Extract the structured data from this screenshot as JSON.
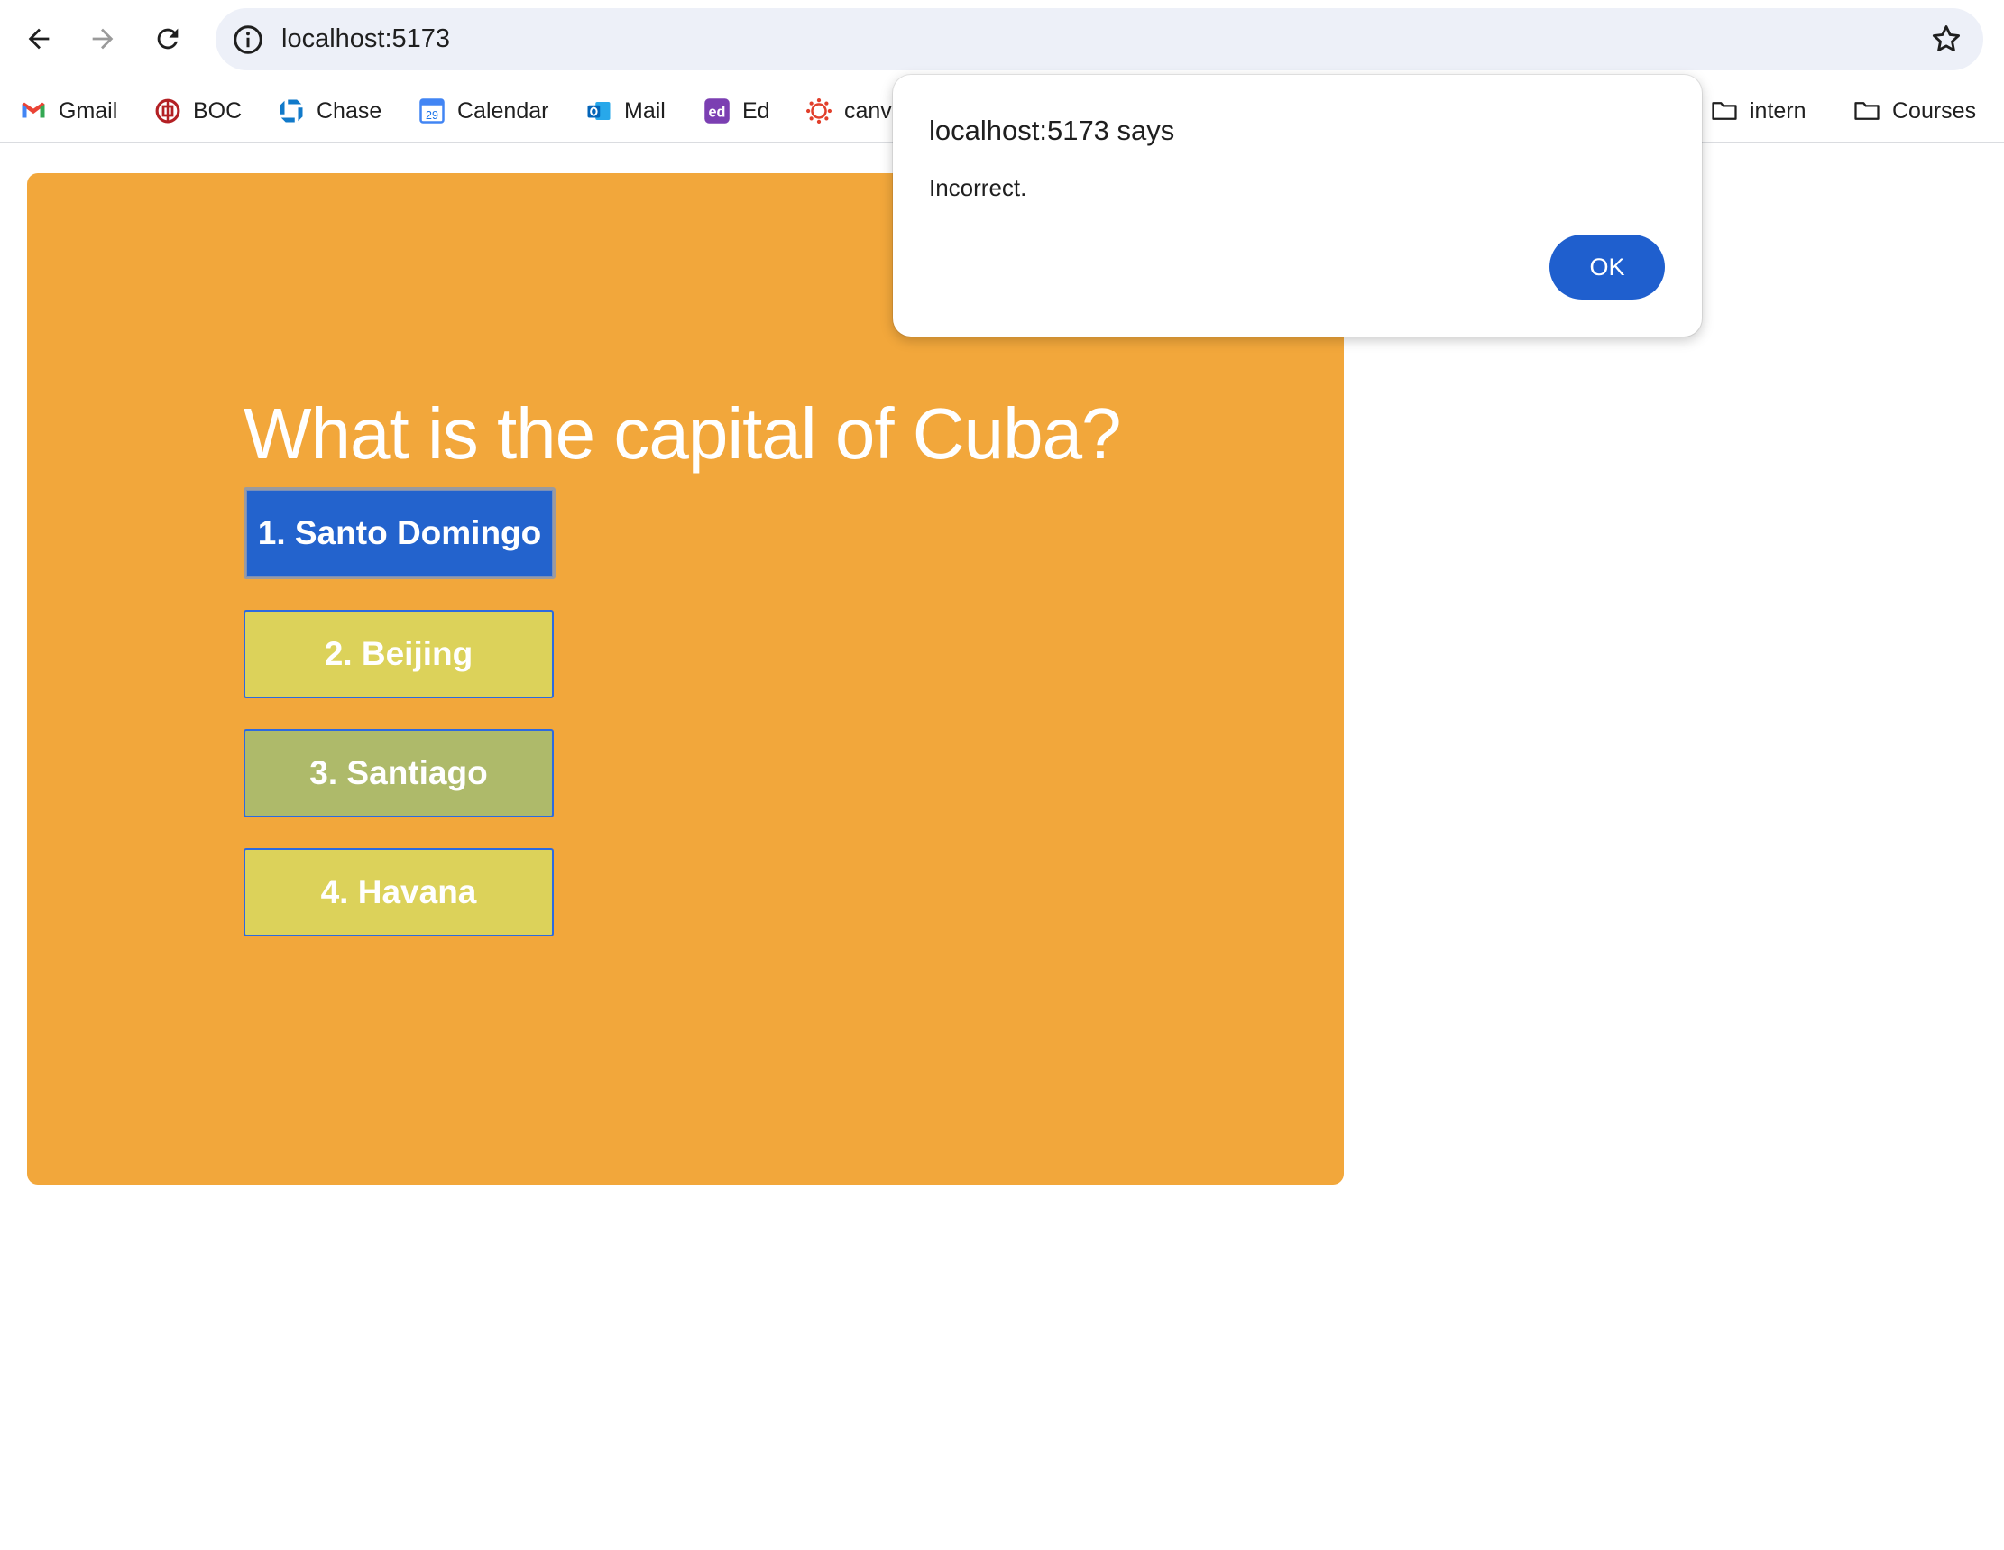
{
  "browser": {
    "url": "localhost:5173",
    "bookmarks": [
      {
        "label": "Gmail",
        "icon": "gmail-icon"
      },
      {
        "label": "BOC",
        "icon": "boc-icon"
      },
      {
        "label": "Chase",
        "icon": "chase-icon"
      },
      {
        "label": "Calendar",
        "icon": "calendar-icon",
        "badge": "29"
      },
      {
        "label": "Mail",
        "icon": "outlook-icon"
      },
      {
        "label": "Ed",
        "icon": "ed-icon"
      },
      {
        "label": "canv",
        "icon": "canvas-icon"
      },
      {
        "label": "intern",
        "icon": "folder-icon"
      },
      {
        "label": "Courses",
        "icon": "folder-icon"
      }
    ],
    "ed_icon_text": "ed"
  },
  "quiz": {
    "question": "What is the capital of Cuba?",
    "answers": [
      {
        "label": "1. Santo Domingo",
        "color": "#2363cd"
      },
      {
        "label": "2. Beijing",
        "color": "#dcd25a"
      },
      {
        "label": "3. Santiago",
        "color": "#aeba6a"
      },
      {
        "label": "4. Havana",
        "color": "#dcd25a"
      }
    ],
    "card_color": "#f2a73b"
  },
  "dialog": {
    "title": "localhost:5173 says",
    "message": "Incorrect.",
    "ok_label": "OK",
    "ok_color": "#1f5fce"
  }
}
